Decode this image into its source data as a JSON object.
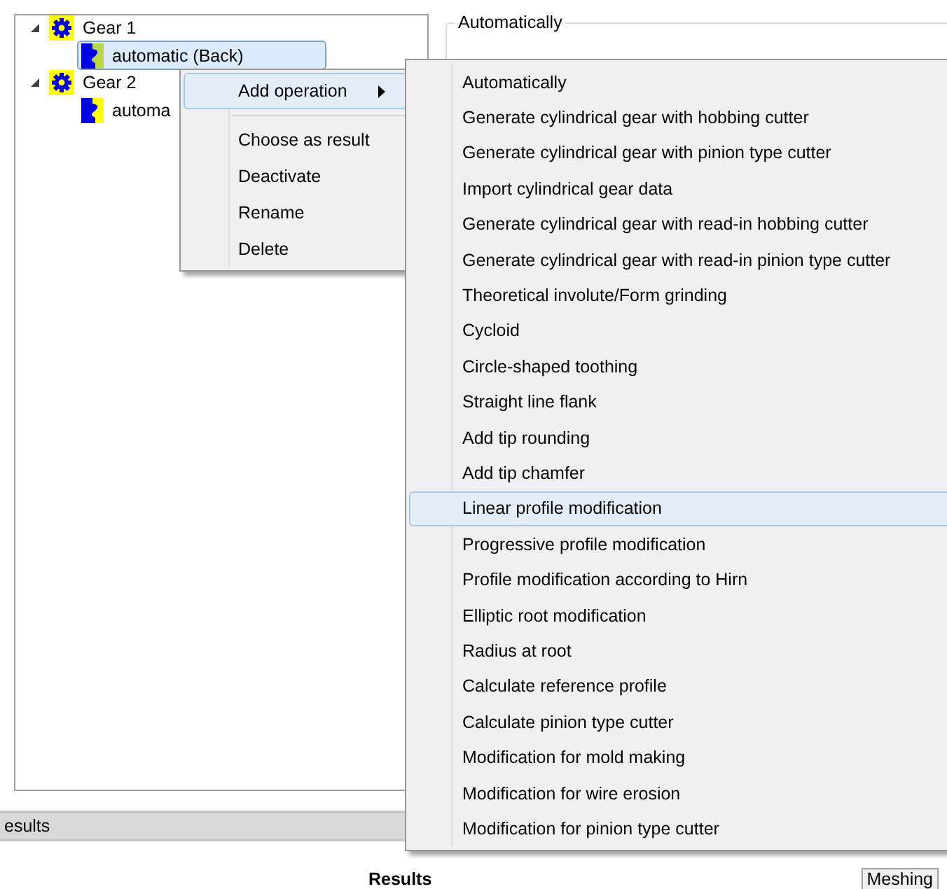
{
  "tree": [
    {
      "label": "Gear 1",
      "expanded": true,
      "children": [
        {
          "label": "automatic (Back)",
          "selected": true
        }
      ]
    },
    {
      "label": "Gear 2",
      "expanded": true,
      "children": [
        {
          "label": "automa",
          "selected": false
        }
      ]
    }
  ],
  "group": {
    "title": "Automatically"
  },
  "bottom_tab": {
    "label": "esults"
  },
  "results_heading": "Results",
  "meshing_tab": {
    "label": "Meshing"
  },
  "context_menu": [
    {
      "label": "Add operation",
      "kind": "submenu",
      "selected": true
    },
    {
      "kind": "separator"
    },
    {
      "label": "Choose as result",
      "kind": "item",
      "selected": false
    },
    {
      "label": "Deactivate",
      "kind": "item",
      "selected": false
    },
    {
      "label": "Rename",
      "kind": "item",
      "selected": false
    },
    {
      "label": "Delete",
      "kind": "item",
      "selected": false
    }
  ],
  "submenu": [
    {
      "label": "Automatically",
      "selected": false
    },
    {
      "label": "Generate cylindrical gear with hobbing cutter",
      "selected": false
    },
    {
      "label": "Generate cylindrical gear with pinion type cutter",
      "selected": false
    },
    {
      "label": "Import cylindrical gear data",
      "selected": false
    },
    {
      "label": "Generate cylindrical gear with read-in hobbing cutter",
      "selected": false
    },
    {
      "label": "Generate cylindrical gear with read-in pinion type cutter",
      "selected": false
    },
    {
      "label": "Theoretical involute/Form grinding",
      "selected": false
    },
    {
      "label": "Cycloid",
      "selected": false
    },
    {
      "label": "Circle-shaped toothing",
      "selected": false
    },
    {
      "label": "Straight line flank",
      "selected": false
    },
    {
      "label": "Add tip rounding",
      "selected": false
    },
    {
      "label": "Add tip chamfer",
      "selected": false
    },
    {
      "label": "Linear profile modification",
      "selected": true
    },
    {
      "label": "Progressive profile modification",
      "selected": false
    },
    {
      "label": "Profile modification according to Hirn",
      "selected": false
    },
    {
      "label": "Elliptic root modification",
      "selected": false
    },
    {
      "label": "Radius at root",
      "selected": false
    },
    {
      "label": "Calculate reference profile",
      "selected": false
    },
    {
      "label": "Calculate pinion type cutter",
      "selected": false
    },
    {
      "label": "Modification for mold making",
      "selected": false
    },
    {
      "label": "Modification for wire erosion",
      "selected": false
    },
    {
      "label": "Modification for pinion type cutter",
      "selected": false
    }
  ]
}
